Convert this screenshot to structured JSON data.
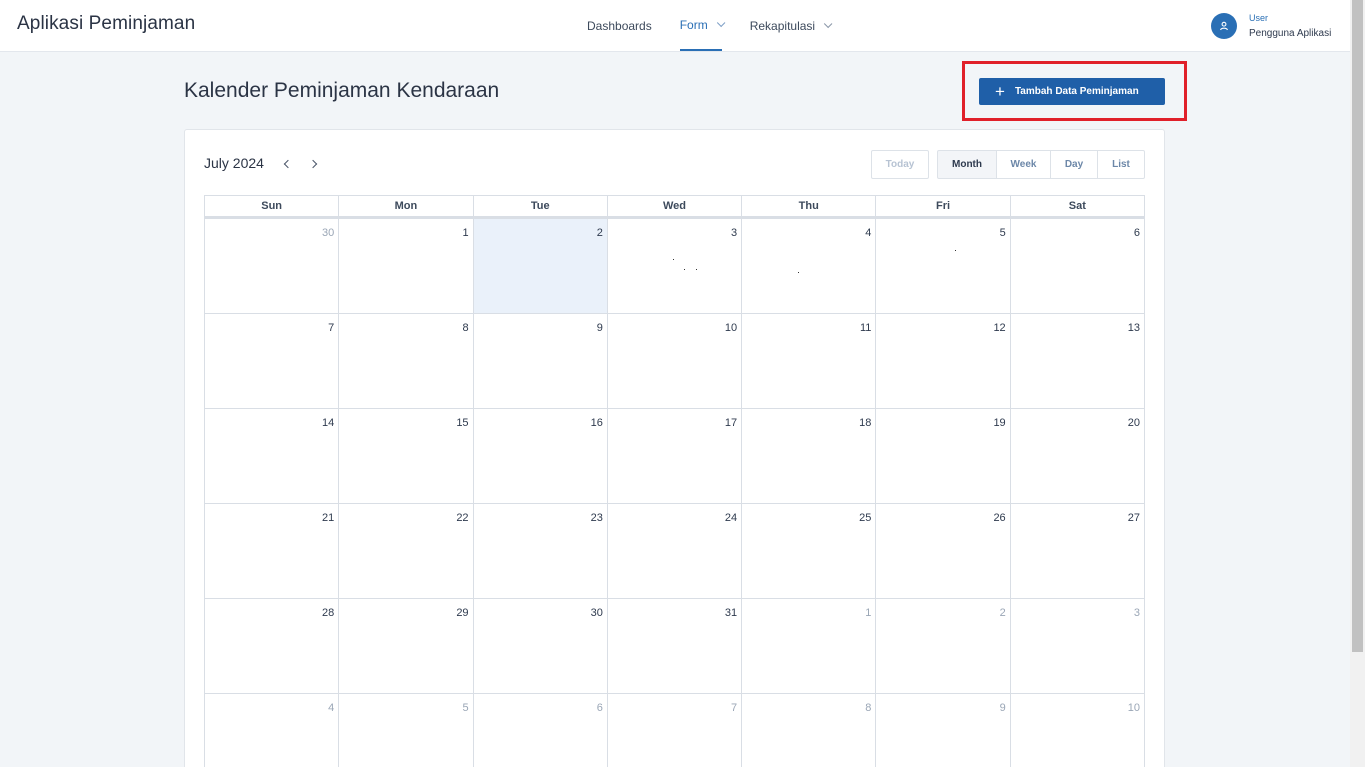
{
  "header": {
    "app_title": "Aplikasi Peminjaman",
    "nav": [
      {
        "label": "Dashboards",
        "active": false,
        "dropdown": false
      },
      {
        "label": "Form",
        "active": true,
        "dropdown": true
      },
      {
        "label": "Rekapitulasi",
        "active": false,
        "dropdown": true
      }
    ],
    "user": {
      "role": "User",
      "name": "Pengguna Aplikasi",
      "icon": "user-icon"
    }
  },
  "page": {
    "title": "Kalender Peminjaman Kendaraan",
    "add_button_label": "Tambah Data Peminjaman",
    "add_button_icon": "plus-icon"
  },
  "calendar": {
    "month_label": "July 2024",
    "prev_icon": "chevron-left-icon",
    "next_icon": "chevron-right-icon",
    "today_label": "Today",
    "views": [
      "Month",
      "Week",
      "Day",
      "List"
    ],
    "active_view": "Month",
    "weekdays": [
      "Sun",
      "Mon",
      "Tue",
      "Wed",
      "Thu",
      "Fri",
      "Sat"
    ],
    "weeks": [
      [
        "30",
        "1",
        "2",
        "3",
        "4",
        "5",
        "6"
      ],
      [
        "7",
        "8",
        "9",
        "10",
        "11",
        "12",
        "13"
      ],
      [
        "14",
        "15",
        "16",
        "17",
        "18",
        "19",
        "20"
      ],
      [
        "21",
        "22",
        "23",
        "24",
        "25",
        "26",
        "27"
      ],
      [
        "28",
        "29",
        "30",
        "31",
        "1",
        "2",
        "3"
      ],
      [
        "4",
        "5",
        "6",
        "7",
        "8",
        "9",
        "10"
      ]
    ],
    "today_date": "2"
  },
  "colors": {
    "primary": "#1f5fa8",
    "accent": "#2a6fb5",
    "highlight_border": "#e0202a",
    "today_bg": "#eaf1fa"
  }
}
